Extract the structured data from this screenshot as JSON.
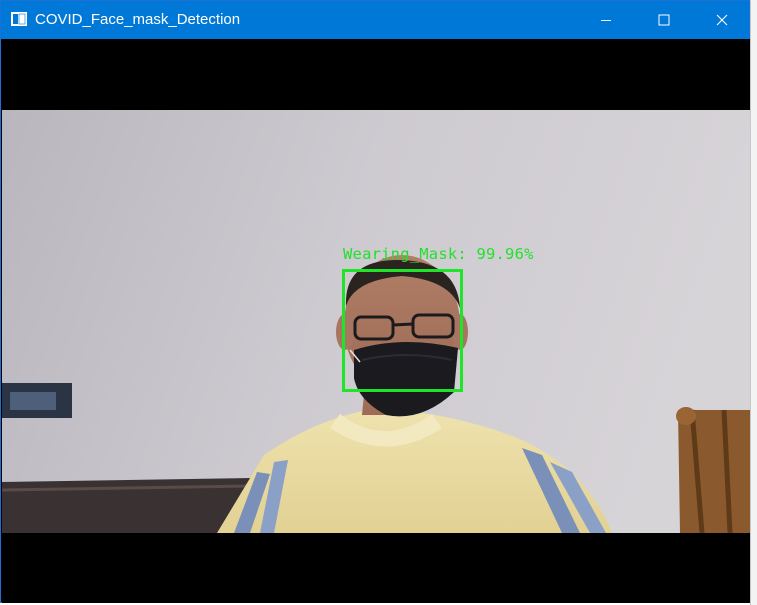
{
  "window": {
    "title": "COVID_Face_mask_Detection",
    "controls": {
      "minimize": "minimize",
      "maximize": "maximize",
      "close": "close"
    }
  },
  "detection": {
    "label": "Wearing_Mask: 99.96%",
    "box_color": "#1fe52a"
  },
  "colors": {
    "titlebar": "#0078d7",
    "frame_background": "#000000"
  }
}
